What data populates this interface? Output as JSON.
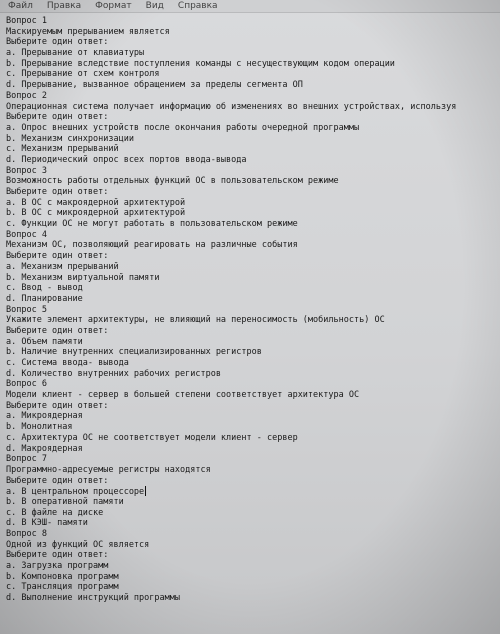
{
  "menu": [
    "Файл",
    "Правка",
    "Формат",
    "Вид",
    "Справка"
  ],
  "lines": [
    "Вопрос 1",
    "Маскируемым прерыванием является",
    "Выберите один ответ:",
    "a. Прерывание от клавиатуры",
    "b. Прерывание вследствие поступления команды с несуществующим кодом операции",
    "c. Прерывание от схем контроля",
    "d. Прерывание, вызванное обращением за пределы сегмента ОП",
    "Вопрос 2",
    "Операционная система получает информацию об изменениях во внешних устройствах, используя",
    "Выберите один ответ:",
    "a. Опрос внешних устройств после окончания работы очередной программы",
    "b. Механизм синхронизации",
    "c. Механизм прерываний",
    "d. Периодический опрос всех портов ввода-вывода",
    "Вопрос 3",
    "Возможность работы отдельных функций ОС в пользовательском режиме",
    "Выберите один ответ:",
    "a. В ОС с макроядерной архитектурой",
    "b. В ОС с микроядерной архитектурой",
    "c. Функции ОС не могут работать в пользовательском режиме",
    "Вопрос 4",
    "Механизм ОС, позволяющий реагировать на различные события",
    "Выберите один ответ:",
    "a. Механизм прерываний",
    "b. Механизм виртуальной памяти",
    "c. Ввод - вывод",
    "d. Планирование",
    "Вопрос 5",
    "Укажите элемент архитектуры, не влияющий на переносимость (мобильность) ОС",
    "Выберите один ответ:",
    "a. Объем памяти",
    "b. Наличие внутренних специализированных регистров",
    "c. Система ввода- вывода",
    "d. Количество внутренних рабочих регистров",
    "Вопрос 6",
    "Модели клиент - сервер в большей степени соответствует архитектура ОС",
    "Выберите один ответ:",
    "a. Микроядерная",
    "b. Монолитная",
    "c. Архитектура ОС не соответствует модели клиент - сервер",
    "d. Макроядерная",
    "Вопрос 7",
    "Программно-адресуемые регистры находятся",
    "Выберите один ответ:",
    "a. В центральном процессоре",
    "b. В оперативной памяти",
    "c. В файле на диске",
    "d. В КЭШ- памяти",
    "Вопрос 8",
    "Одной из функций ОС является",
    "Выберите один ответ:",
    "a. Загрузка программ",
    "b. Компоновка программ",
    "c. Трансляция программ",
    "d. Выполнение инструкций программы"
  ],
  "caret_line": 44
}
